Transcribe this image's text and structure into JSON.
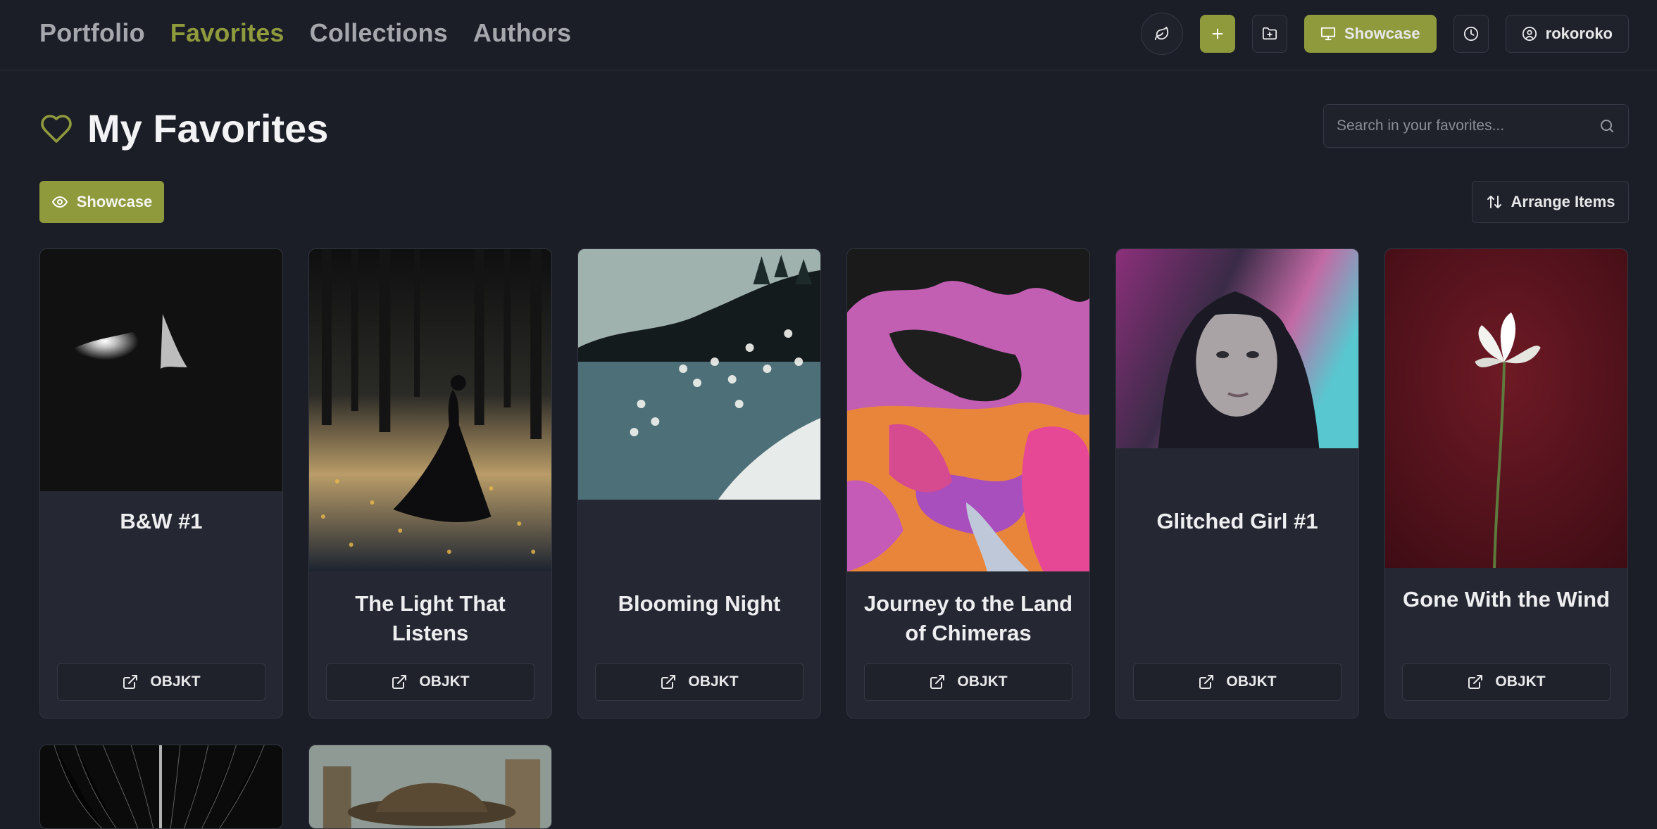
{
  "nav": {
    "items": [
      {
        "label": "Portfolio",
        "active": false
      },
      {
        "label": "Favorites",
        "active": true
      },
      {
        "label": "Collections",
        "active": false
      },
      {
        "label": "Authors",
        "active": false
      }
    ]
  },
  "top_actions": {
    "leaf_icon": "leaf-icon",
    "add_icon": "plus-icon",
    "folder_icon": "folder-plus-icon",
    "showcase_label": "Showcase",
    "history_icon": "clock-icon",
    "user_label": "rokoroko"
  },
  "page": {
    "title": "My Favorites",
    "search_placeholder": "Search in your favorites...",
    "showcase_label": "Showcase",
    "arrange_label": "Arrange Items"
  },
  "colors": {
    "background": "#1c1e27",
    "accent": "#8e9a3c",
    "card": "#252832"
  },
  "cards": [
    {
      "title": "B&W #1",
      "button": "OBJKT"
    },
    {
      "title": "The Light That Listens",
      "button": "OBJKT"
    },
    {
      "title": "Blooming Night",
      "button": "OBJKT"
    },
    {
      "title": "Journey to the Land of Chimeras",
      "button": "OBJKT"
    },
    {
      "title": "Glitched Girl #1",
      "button": "OBJKT"
    },
    {
      "title": "Gone With the Wind",
      "button": "OBJKT"
    }
  ]
}
